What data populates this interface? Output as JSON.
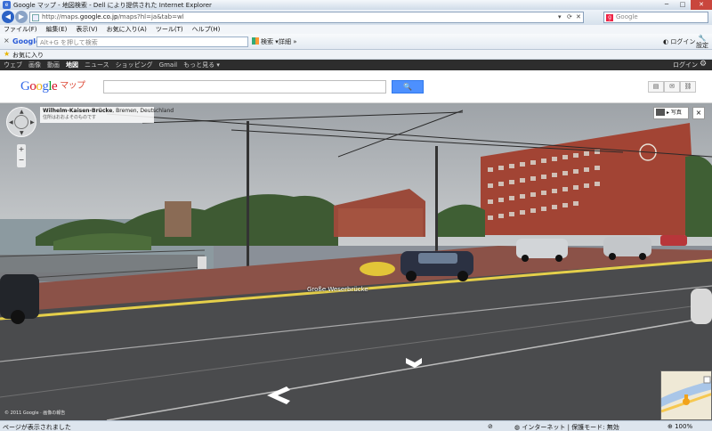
{
  "window": {
    "title": "Google マップ - 地図検索 - Dell により提供された Internet Explorer",
    "min": "─",
    "max": "□",
    "close": "✕"
  },
  "addressbar": {
    "url_prefix": "http://maps.",
    "url_domain": "google.co.jp",
    "url_suffix": "/maps?hl=ja&tab=wl",
    "search_placeholder": "Google"
  },
  "menu": [
    "ファイル(F)",
    "編集(E)",
    "表示(V)",
    "お気に入り(A)",
    "ツール(T)",
    "ヘルプ(H)"
  ],
  "google_toolbar": {
    "close": "×",
    "logo": "Google",
    "placeholder": "Alt+G を押して検索",
    "search_label": "検索 ▾",
    "detail_label": "詳細 »",
    "login_label": "ログイン",
    "settings_label": "設定"
  },
  "favorites": {
    "label": "お気に入り"
  },
  "google_nav": {
    "links": [
      "ウェブ",
      "画像",
      "動画",
      "地図",
      "ニュース",
      "ショッピング",
      "Gmail",
      "もっと見る ▾"
    ],
    "active_index": 3,
    "login": "ログイン"
  },
  "maps_header": {
    "logo_letters": [
      "G",
      "o",
      "o",
      "g",
      "l",
      "e"
    ],
    "maps_label": "マップ",
    "search_value": ""
  },
  "street_view": {
    "address_main": "Wilhelm-Kaisen-Brücke",
    "address_city": ", Bremen, Deutschland",
    "address_note": "住所はおおよそのものです",
    "photo_button": "▸ 写真",
    "close_button": "×",
    "zoom_in": "+",
    "zoom_out": "−",
    "road_label": "Große Weserbrücke",
    "copyright": "© 2011 Google · 画像の報告"
  },
  "statusbar": {
    "status": "ページが表示されました",
    "zone": "インターネット | 保護モード: 無効",
    "zoom": "100%"
  }
}
